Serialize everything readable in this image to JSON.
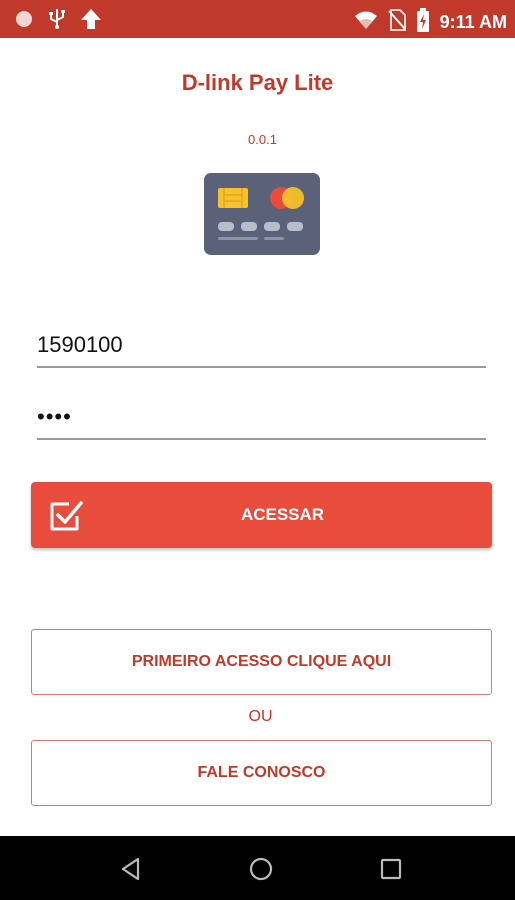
{
  "status_bar": {
    "time": "9:11 AM",
    "left_icons": [
      "record-icon",
      "usb-icon",
      "upload-arrow-icon"
    ],
    "right_icons": [
      "wifi-icon",
      "no-sim-icon",
      "battery-charging-icon"
    ],
    "color": "#c0392b"
  },
  "app": {
    "title": "D-link Pay Lite",
    "version": "0.0.1",
    "logo_icon": "credit-card-icon"
  },
  "login": {
    "user_value": "1590100",
    "password_value": "••••"
  },
  "actions": {
    "access_label": "ACESSAR",
    "access_icon": "checkbox-checked-icon",
    "first_access_label": "PRIMEIRO ACESSO CLIQUE AQUI",
    "or_text": "OU",
    "contact_label": "FALE CONOSCO"
  },
  "nav_bar": {
    "icons": [
      "back-icon",
      "home-icon",
      "recents-icon"
    ]
  },
  "colors": {
    "accent": "#c0392b",
    "button_fill": "#e74c3c",
    "card": "#5b6179"
  }
}
